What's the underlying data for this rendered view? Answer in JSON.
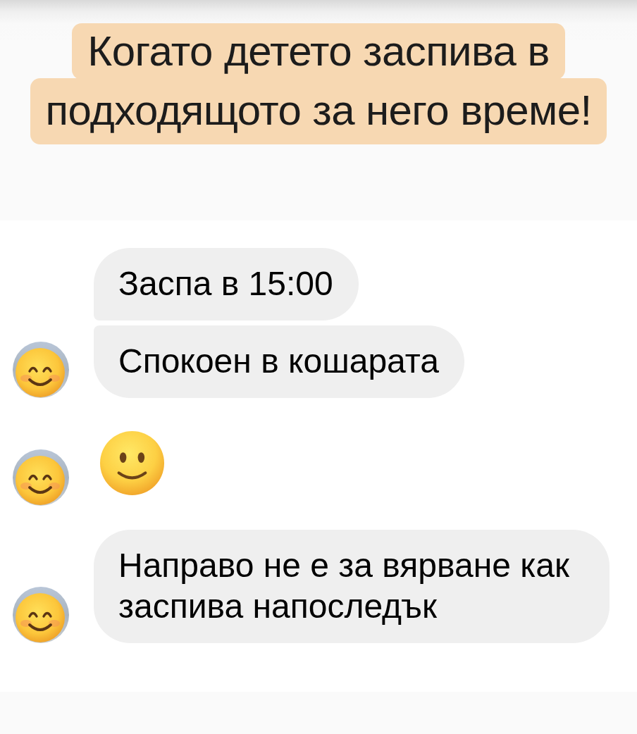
{
  "caption": {
    "lines": [
      "Когато детето заспива в",
      "подходящото за него време!"
    ]
  },
  "message_groups": [
    {
      "avatar": true,
      "messages": [
        {
          "kind": "text",
          "text": "Заспа в 15:00"
        },
        {
          "kind": "text",
          "text": "Спокоен в кошарата"
        }
      ]
    },
    {
      "avatar": true,
      "messages": [
        {
          "kind": "emoji"
        }
      ]
    },
    {
      "avatar": true,
      "messages": [
        {
          "kind": "text",
          "text": "Направо не е за вярване как заспива напоследък"
        }
      ]
    }
  ]
}
